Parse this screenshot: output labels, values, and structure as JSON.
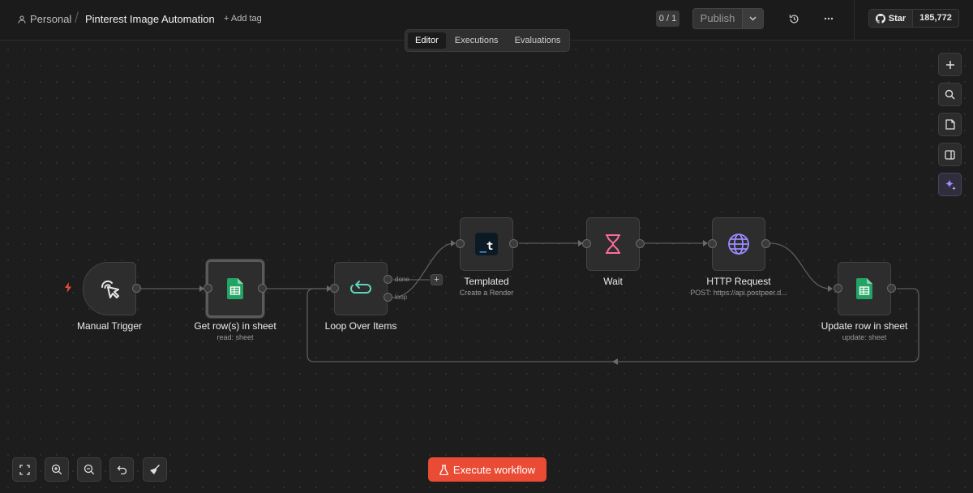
{
  "header": {
    "project": "Personal",
    "separator": "/",
    "workflow_title": "Pinterest Image Automation",
    "add_tag": "+ Add tag",
    "version_counter": "0 / 1",
    "publish_label": "Publish",
    "github_star_label": "Star",
    "github_star_count": "185,772",
    "history_icon": "history-icon",
    "more_icon": "more-horizontal-icon"
  },
  "tabs": [
    {
      "label": "Editor",
      "active": true
    },
    {
      "label": "Executions",
      "active": false
    },
    {
      "label": "Evaluations",
      "active": false
    }
  ],
  "nodes": {
    "manual_trigger": {
      "label": "Manual Trigger",
      "subtitle": "",
      "icon": "cursor-click-icon"
    },
    "get_rows": {
      "label": "Get row(s) in sheet",
      "subtitle": "read: sheet",
      "icon": "google-sheets-icon"
    },
    "loop": {
      "label": "Loop Over Items",
      "subtitle": "",
      "icon": "loop-icon",
      "outputs": [
        "done",
        "loop"
      ]
    },
    "templated": {
      "label": "Templated",
      "subtitle": "Create a Render",
      "icon": "templated-icon"
    },
    "wait": {
      "label": "Wait",
      "subtitle": "",
      "icon": "hourglass-icon"
    },
    "http": {
      "label": "HTTP Request",
      "subtitle": "POST: https://api.postpeer.d...",
      "icon": "globe-icon"
    },
    "update_row": {
      "label": "Update row in sheet",
      "subtitle": "update: sheet",
      "icon": "google-sheets-icon"
    }
  },
  "canvas_controls": {
    "add_node_icon": "plus-icon",
    "search_icon": "search-icon",
    "sticky_note_icon": "sticky-note-icon",
    "panel_icon": "side-panel-icon",
    "ai_assistant_icon": "sparkle-icon"
  },
  "bottom_controls": {
    "fit_view_icon": "fit-view-icon",
    "zoom_in_icon": "zoom-in-icon",
    "zoom_out_icon": "zoom-out-icon",
    "reset_icon": "undo-icon",
    "tidy_up_icon": "broom-icon",
    "execute_label": "Execute workflow"
  },
  "colors": {
    "accent": "#ea4b35",
    "sheets_green": "#21a464",
    "loop_teal": "#5fd4c0",
    "wait_pink": "#ff6b9a",
    "http_purple": "#9b8cff",
    "ai_purple": "#a78bfa"
  }
}
